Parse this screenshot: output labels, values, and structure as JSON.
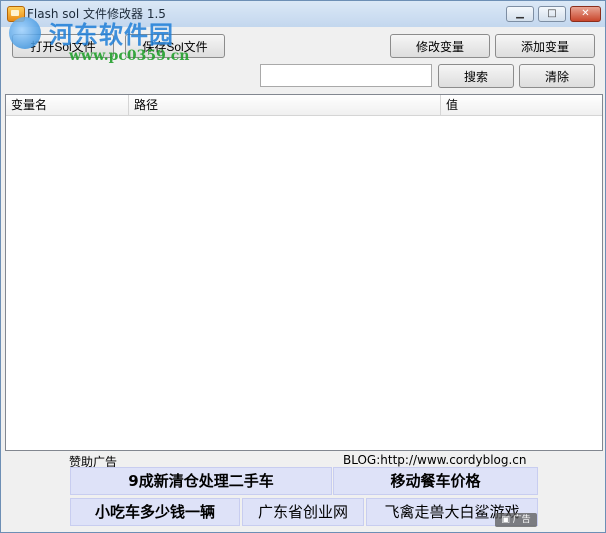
{
  "window": {
    "title": "Flash sol 文件修改器 1.5"
  },
  "watermark": {
    "name": "河东软件园",
    "url": "www.pc0359.cn"
  },
  "window_controls": {
    "minimize": "▁",
    "maximize": "□",
    "close": "✕"
  },
  "toolbar": {
    "open": "打开Sol文件",
    "save": "保存Sol文件",
    "modify": "修改变量",
    "add": "添加变量",
    "search": "搜索",
    "clear": "清除"
  },
  "search": {
    "value": "",
    "placeholder": ""
  },
  "table": {
    "columns": [
      "变量名",
      "路径",
      "值"
    ],
    "rows": []
  },
  "ads": {
    "label": "赞助广告",
    "blog": "BLOG:http://www.cordyblog.cn",
    "items": [
      "9成新清仓处理二手车",
      "移动餐车价格",
      "小吃车多少钱一辆",
      "广东省创业网",
      "飞禽走兽大白鲨游戏"
    ],
    "mark": "▣ 广告"
  }
}
